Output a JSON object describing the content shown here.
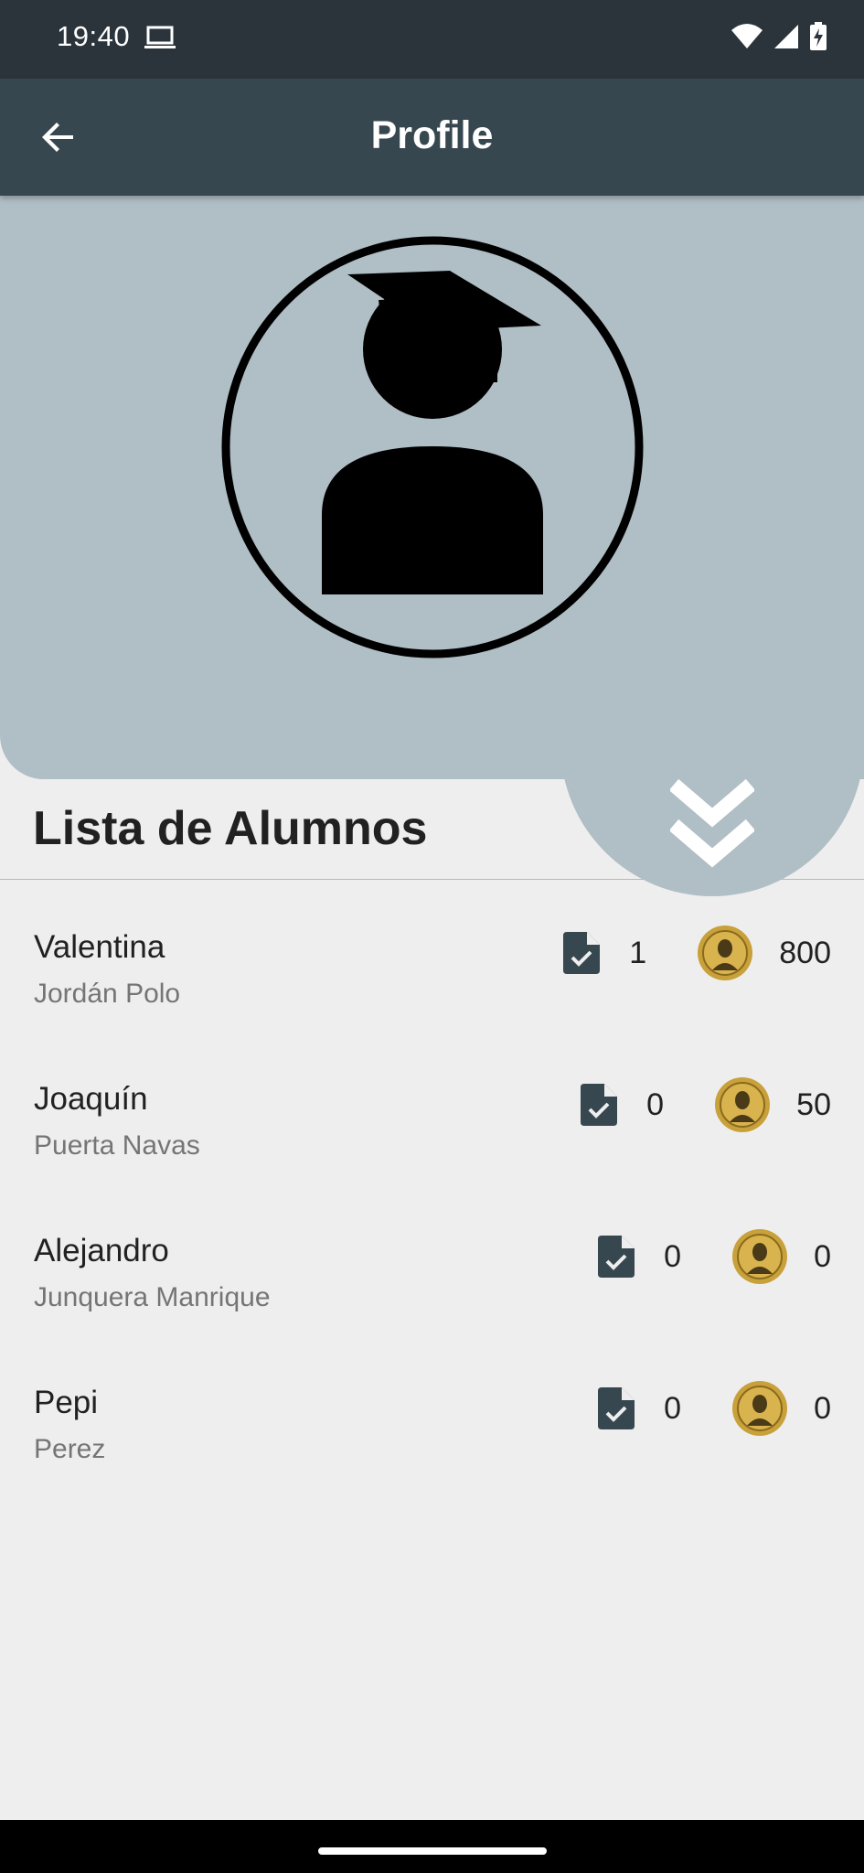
{
  "status_bar": {
    "time": "19:40",
    "icons": [
      "laptop-icon",
      "wifi-icon",
      "signal-icon",
      "battery-charging-icon"
    ]
  },
  "app_bar": {
    "title": "Profile",
    "back_icon": "arrow-back-icon"
  },
  "header": {
    "avatar_icon": "graduate-avatar-icon",
    "expand_icon": "double-chevron-down-icon",
    "background_color": "#b0bec5"
  },
  "list": {
    "title": "Lista de Alumnos",
    "students": [
      {
        "name": "Valentina",
        "surname": "Jordán Polo",
        "tasks": "1",
        "coins": "800"
      },
      {
        "name": "Joaquín",
        "surname": "Puerta Navas",
        "tasks": "0",
        "coins": "50"
      },
      {
        "name": "Alejandro",
        "surname": "Junquera Manrique",
        "tasks": "0",
        "coins": "0"
      },
      {
        "name": "Pepi",
        "surname": "Perez",
        "tasks": "0",
        "coins": "0"
      }
    ]
  },
  "colors": {
    "status_bar": "#2b343b",
    "app_bar": "#37474f",
    "accent_icon": "#37474f",
    "background": "#eeeeee",
    "coin_gold": "#c9a13a"
  }
}
